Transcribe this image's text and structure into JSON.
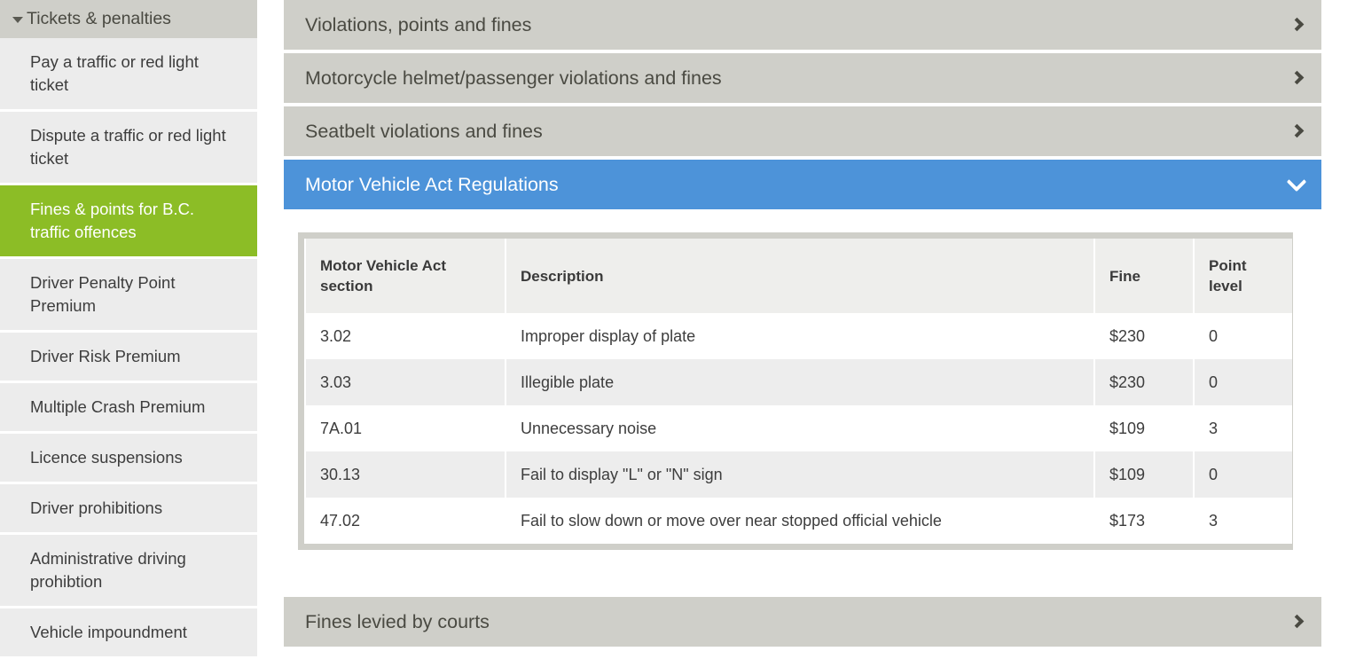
{
  "sidebar": {
    "header": {
      "label": "Tickets & penalties",
      "icon": "triangle-down-icon"
    },
    "items": [
      {
        "label": "Pay a traffic or red light ticket",
        "active": false
      },
      {
        "label": "Dispute a traffic or red light ticket",
        "active": false
      },
      {
        "label": "Fines & points for B.C. traffic offences",
        "active": true
      },
      {
        "label": "Driver Penalty Point Premium",
        "active": false
      },
      {
        "label": "Driver Risk Premium",
        "active": false
      },
      {
        "label": "Multiple Crash Premium",
        "active": false
      },
      {
        "label": "Licence suspensions",
        "active": false
      },
      {
        "label": "Driver prohibitions",
        "active": false
      },
      {
        "label": "Administrative driving prohibtion",
        "active": false
      },
      {
        "label": "Vehicle impoundment",
        "active": false
      }
    ]
  },
  "accordions": [
    {
      "title": "Violations, points and fines",
      "state": "collapsed",
      "icon": "chevron-right-icon"
    },
    {
      "title": "Motorcycle helmet/passenger violations and fines",
      "state": "collapsed",
      "icon": "chevron-right-icon"
    },
    {
      "title": "Seatbelt violations and fines",
      "state": "collapsed",
      "icon": "chevron-right-icon"
    },
    {
      "title": "Motor Vehicle Act Regulations",
      "state": "expanded",
      "icon": "chevron-down-icon"
    }
  ],
  "footer_accordion": {
    "title": "Fines levied by courts",
    "state": "collapsed",
    "icon": "chevron-right-icon"
  },
  "table": {
    "headers": [
      "Motor Vehicle Act section",
      "Description",
      "Fine",
      "Point level"
    ],
    "rows": [
      {
        "section": "3.02",
        "description": "Improper display of plate",
        "fine": "$230",
        "points": "0"
      },
      {
        "section": "3.03",
        "description": "Illegible plate",
        "fine": "$230",
        "points": "0"
      },
      {
        "section": "7A.01",
        "description": "Unnecessary noise",
        "fine": "$109",
        "points": "3"
      },
      {
        "section": "30.13",
        "description": "Fail to display \"L\" or \"N\" sign",
        "fine": "$109",
        "points": "0"
      },
      {
        "section": "47.02",
        "description": "Fail to slow down or move over near stopped official vehicle",
        "fine": "$173",
        "points": "3"
      }
    ]
  },
  "colors": {
    "sidebar_active": "#8cbd26",
    "accordion_gray": "#cfcfc9",
    "accordion_active_blue": "#4d93d9",
    "row_alt": "#ededed",
    "text": "#3d3d3d"
  }
}
